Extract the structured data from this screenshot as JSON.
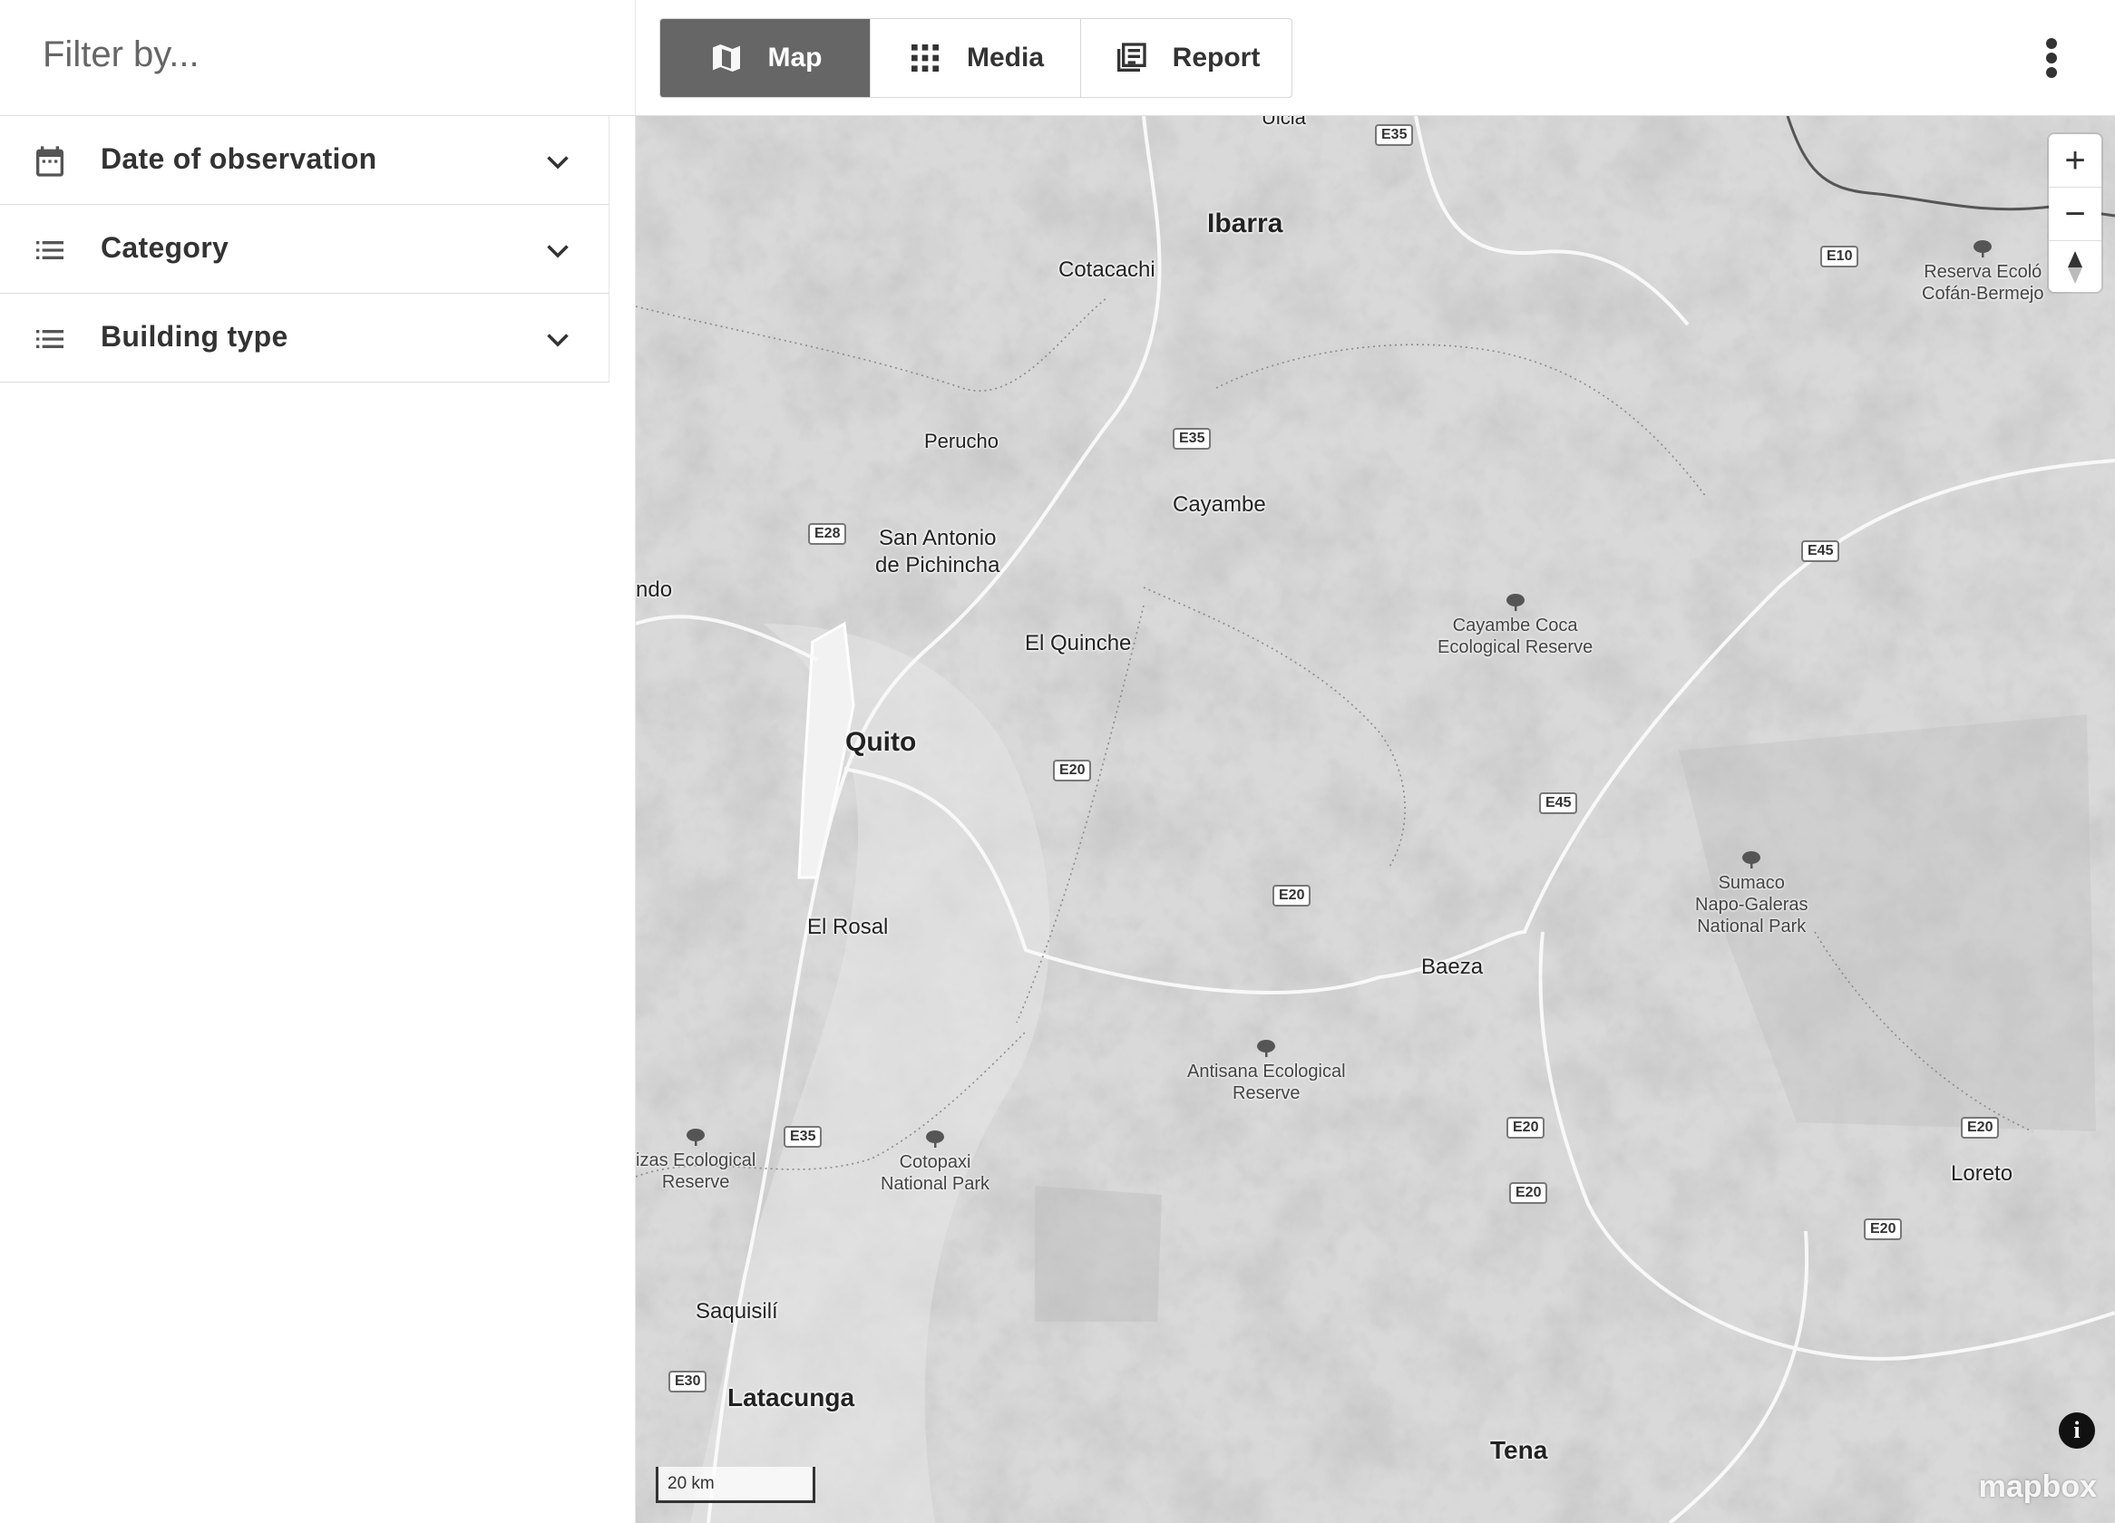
{
  "sidebar": {
    "filter_title": "Filter by...",
    "filters": [
      {
        "label": "Date of observation",
        "icon": "calendar-icon"
      },
      {
        "label": "Category",
        "icon": "list-icon"
      },
      {
        "label": "Building type",
        "icon": "list-icon"
      }
    ]
  },
  "toolbar": {
    "tabs": [
      {
        "label": "Map",
        "icon": "map-icon",
        "active": true
      },
      {
        "label": "Media",
        "icon": "grid-icon",
        "active": false
      },
      {
        "label": "Report",
        "icon": "report-icon",
        "active": false
      }
    ]
  },
  "map": {
    "places": {
      "ibarra": "Ibarra",
      "cotacachi": "Cotacachi",
      "perucho": "Perucho",
      "cayambe": "Cayambe",
      "san_antonio": "San Antonio\nde Pichincha",
      "ndo": "ndo",
      "el_quinche": "El Quinche",
      "quito": "Quito",
      "el_rosal": "El Rosal",
      "baeza": "Baeza",
      "saquisili": "Saquisilí",
      "latacunga": "Latacunga",
      "tena": "Tena",
      "loreto": "Loreto",
      "ulcia": "Ulcia"
    },
    "parks": {
      "reserva_cofan": "Reserva Ecoló\nCofán-Bermejo",
      "cayambe_coca": "Cayambe Coca\nEcological Reserve",
      "sumaco": "Sumaco\nNapo-Galeras\nNational Park",
      "antisana": "Antisana Ecological\nReserve",
      "cotopaxi": "Cotopaxi\nNational Park",
      "ilinizas": "izas Ecological\nReserve"
    },
    "roads": {
      "e35_top": "E35",
      "e10": "E10",
      "e35_mid": "E35",
      "e28": "E28",
      "e45_top": "E45",
      "e20_a": "E20",
      "e45_mid": "E45",
      "e20_b": "E20",
      "e35_low": "E35",
      "e20_c": "E20",
      "e20_d": "E20",
      "e20_e": "E20",
      "e20_f": "E20",
      "e30": "E30"
    },
    "scale": "20 km",
    "attribution": "mapbox",
    "zoom_in": "+",
    "zoom_out": "−",
    "info": "i"
  },
  "colors": {
    "active_tab": "#666666",
    "map_base": "#dadada"
  }
}
